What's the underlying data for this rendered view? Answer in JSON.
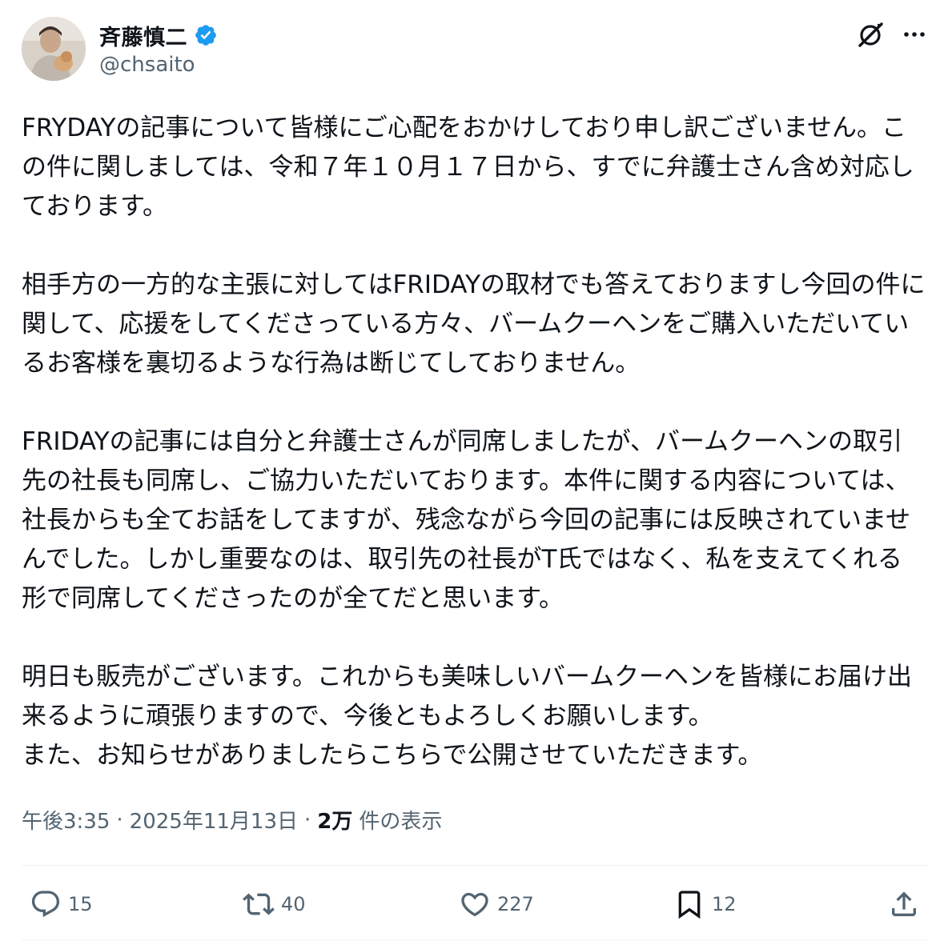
{
  "author": {
    "display_name": "斉藤慎二",
    "handle": "@chsaito",
    "verified": true,
    "verified_color": "#1d9bf0"
  },
  "header_icons": {
    "grok": "grok-icon",
    "more": "more-icon"
  },
  "post": {
    "text": "FRYDAYの記事について皆様にご心配をおかけしており申し訳ございません。この件に関しましては、令和７年１０月１７日から、すでに弁護士さん含め対応しております。\n\n相手方の一方的な主張に対してはFRIDAYの取材でも答えておりますし今回の件に関して、応援をしてくださっている方々、バームクーヘンをご購入いただいているお客様を裏切るような行為は断じてしておりません。\n\nFRIDAYの記事には自分と弁護士さんが同席しましたが、バームクーヘンの取引先の社長も同席し、ご協力いただいております。本件に関する内容については、社長からも全てお話をしてますが、残念ながら今回の記事には反映されていませんでした。しかし重要なのは、取引先の社長がT氏ではなく、私を支えてくれる形で同席してくださったのが全てだと思います。\n\n明日も販売がございます。これからも美味しいバームクーヘンを皆様にお届け出来るように頑張りますので、今後ともよろしくお願いします。\nまた、お知らせがありましたらこちらで公開させていただきます。"
  },
  "meta": {
    "time": "午後3:35",
    "separator": "·",
    "date": "2025年11月13日",
    "views_count": "2万",
    "views_label": "件の表示"
  },
  "actions": {
    "reply": {
      "icon": "reply-icon",
      "count": "15"
    },
    "repost": {
      "icon": "repost-icon",
      "count": "40"
    },
    "like": {
      "icon": "heart-icon",
      "count": "227"
    },
    "bookmark": {
      "icon": "bookmark-icon",
      "count": "12"
    },
    "share": {
      "icon": "share-icon"
    }
  },
  "colors": {
    "text": "#0f1419",
    "secondary": "#536471",
    "divider": "#eff3f4",
    "accent": "#1d9bf0"
  }
}
